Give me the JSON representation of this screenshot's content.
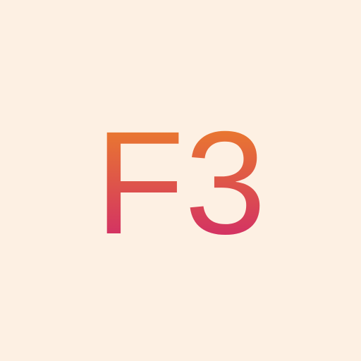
{
  "logo": {
    "text": "F3",
    "gradient_top": "#ef8a22",
    "gradient_bottom": "#cd1f72",
    "background": "#fdf0e3"
  }
}
